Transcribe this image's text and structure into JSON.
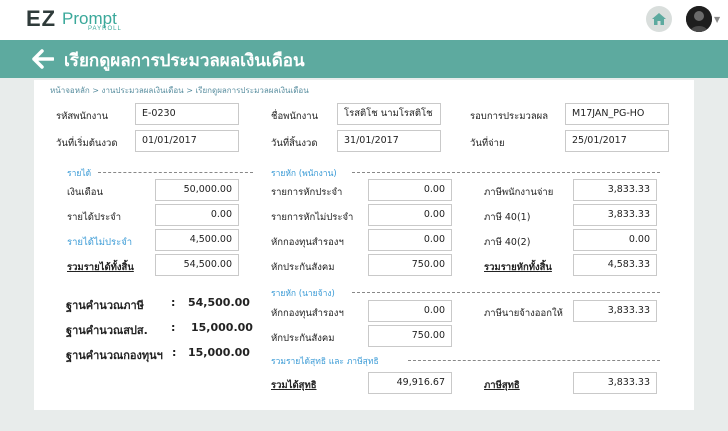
{
  "app": {
    "logo_ez": "EZ",
    "logo_prompt": "Prompt",
    "logo_payroll": "PAYROLL"
  },
  "header": {
    "title": "เรียกดูผลการประมวลผลเงินเดือน"
  },
  "breadcrumb": "หน้าจอหลัก > งานประมวลผลเงินเดือน > เรียกดูผลการประมวลผลเงินเดือน",
  "info": {
    "emp_code_label": "รหัสพนักงาน",
    "emp_code": "E-0230",
    "emp_name_label": "ชื่อพนักงาน",
    "emp_name": "โรสติโช นามโรสติโช",
    "period_label": "รอบการประมวลผล",
    "period": "M17JAN_PG-HO",
    "start_label": "วันที่เริ่มต้นงวด",
    "start": "01/01/2017",
    "end_label": "วันที่สิ้นงวด",
    "end": "31/01/2017",
    "pay_label": "วันที่จ่าย",
    "pay": "25/01/2017"
  },
  "income": {
    "section": "รายได้",
    "salary_label": "เงินเดือน",
    "salary": "50,000.00",
    "regular_label": "รายได้ประจำ",
    "regular": "0.00",
    "irregular_label": "รายได้ไม่ประจำ",
    "irregular": "4,500.00",
    "total_label": "รวมรายได้ทั้งสิ้น",
    "total": "54,500.00"
  },
  "bases": {
    "tax_label": "ฐานคำนวณภาษี",
    "tax": "54,500.00",
    "sso_label": "ฐานคำนวณสปส.",
    "sso": "15,000.00",
    "fund_label": "ฐานคำนวณกองทุนฯ",
    "fund": "15,000.00",
    "colon": ":"
  },
  "emp_deduct": {
    "section": "รายหัก (พนักงาน)",
    "regular_label": "รายการหักประจำ",
    "regular": "0.00",
    "irregular_label": "รายการหักไม่ประจำ",
    "irregular": "0.00",
    "fund_label": "หักกองทุนสำรองฯ",
    "fund": "0.00",
    "sso_label": "หักประกันสังคม",
    "sso": "750.00",
    "emp_tax_label": "ภาษีพนักงานจ่าย",
    "emp_tax": "3,833.33",
    "tax40_1_label": "ภาษี 40(1)",
    "tax40_1": "3,833.33",
    "tax40_2_label": "ภาษี 40(2)",
    "tax40_2": "0.00",
    "total_label": "รวมรายหักทั้งสิ้น",
    "total": "4,583.33"
  },
  "er_deduct": {
    "section": "รายหัก (นายจ้าง)",
    "fund_label": "หักกองทุนสำรองฯ",
    "fund": "0.00",
    "sso_label": "หักประกันสังคม",
    "sso": "750.00",
    "er_tax_label": "ภาษีนายจ้างออกให้",
    "er_tax": "3,833.33"
  },
  "net": {
    "section": "รวมรายได้สุทธิ และ ภาษีสุทธิ",
    "income_label": "รวมได้สุทธิ",
    "income": "49,916.67",
    "tax_label": "ภาษีสุทธิ",
    "tax": "3,833.33"
  },
  "colors": {
    "accent": "#5daa9f",
    "link": "#3b9bd6"
  }
}
